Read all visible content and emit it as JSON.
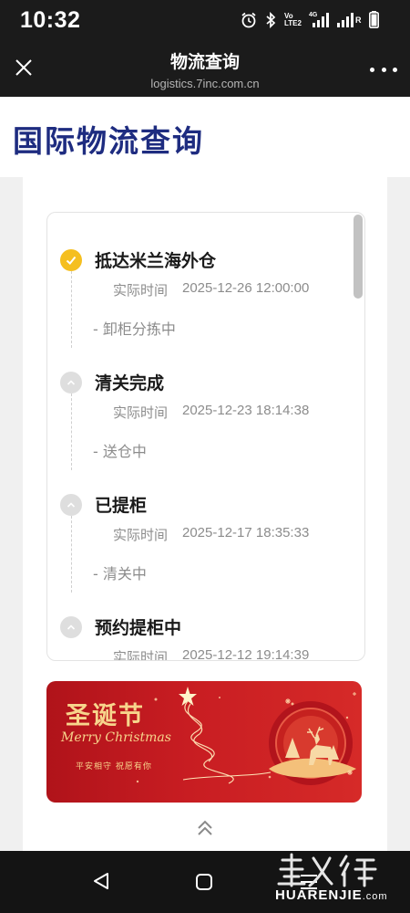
{
  "status_bar": {
    "time": "10:32",
    "icons": [
      "alarm-icon",
      "bluetooth-icon",
      "volte-icon",
      "signal-icon",
      "signal-icon",
      "battery-icon"
    ],
    "network_label": "4G",
    "volte_label": "Vo LTE2",
    "roaming_label": "R"
  },
  "webview_header": {
    "title": "物流查询",
    "url": "logistics.7inc.com.cn"
  },
  "page": {
    "title": "国际物流查询",
    "title_color": "#1e2c80"
  },
  "timeline": {
    "time_label": "实际时间",
    "events": [
      {
        "title": "抵达米兰海外仓",
        "time": "2025-12-26 12:00:00",
        "note": "- 卸柜分拣中",
        "status": "done"
      },
      {
        "title": "清关完成",
        "time": "2025-12-23 18:14:38",
        "note": "- 送仓中",
        "status": "pending"
      },
      {
        "title": "已提柜",
        "time": "2025-12-17 18:35:33",
        "note": "- 清关中",
        "status": "pending"
      },
      {
        "title": "预约提柜中",
        "time": "2025-12-12 19:14:39",
        "note": "",
        "status": "pending"
      }
    ]
  },
  "xmas_banner": {
    "title": "圣诞节",
    "subtitle": "Merry Christmas",
    "caption": "平安相守 祝愿有你"
  },
  "watermark": {
    "text": "HUARENJIE",
    "suffix": ".com"
  },
  "colors": {
    "accent": "#f5bf1f",
    "banner_red": "#c81d22",
    "gold": "#f7d58c"
  }
}
